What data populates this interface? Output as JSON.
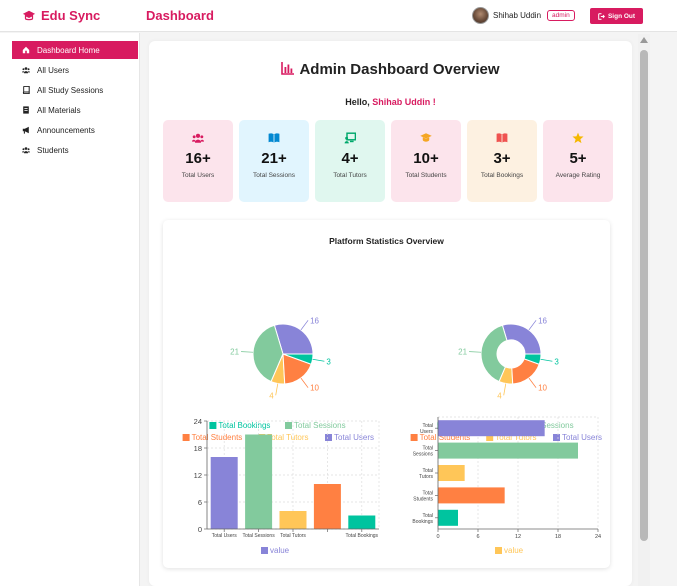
{
  "app": {
    "brand": "Edu Sync",
    "page_title": "Dashboard"
  },
  "user": {
    "name": "Shihab Uddin",
    "role": "admin",
    "sign_out": "Sign Out"
  },
  "sidebar": {
    "items": [
      {
        "label": "Dashboard Home",
        "icon": "home-icon",
        "active": true
      },
      {
        "label": "All Users",
        "icon": "users-icon",
        "active": false
      },
      {
        "label": "All Study Sessions",
        "icon": "book-icon",
        "active": false
      },
      {
        "label": "All Materials",
        "icon": "materials-icon",
        "active": false
      },
      {
        "label": "Announcements",
        "icon": "megaphone-icon",
        "active": false
      },
      {
        "label": "Students",
        "icon": "students-icon",
        "active": false
      }
    ]
  },
  "main": {
    "title": "Admin Dashboard Overview",
    "hello_prefix": "Hello, ",
    "hello_name": "Shihab Uddin !",
    "cards": [
      {
        "value": "16+",
        "label": "Total Users",
        "icon": "users-icon",
        "bg": "#fce4ec",
        "color": "#d81b60"
      },
      {
        "value": "21+",
        "label": "Total Sessions",
        "icon": "book-open-icon",
        "bg": "#e1f5fe",
        "color": "#0288d1"
      },
      {
        "value": "4+",
        "label": "Total Tutors",
        "icon": "chalkboard-icon",
        "bg": "#e0f7ef",
        "color": "#00a86b"
      },
      {
        "value": "10+",
        "label": "Total Students",
        "icon": "graduation-cap-icon",
        "bg": "#fce4ec",
        "color": "#f5a623"
      },
      {
        "value": "3+",
        "label": "Total Bookings",
        "icon": "book-open-icon",
        "bg": "#fdf1e1",
        "color": "#ef5350"
      },
      {
        "value": "5+",
        "label": "Average Rating",
        "icon": "star-icon",
        "bg": "#fce4ec",
        "color": "#f5b800"
      }
    ]
  },
  "stats": {
    "title": "Platform Statistics Overview"
  },
  "chart_data": [
    {
      "type": "pie",
      "categories": [
        "Total Users",
        "Total Sessions",
        "Total Tutors",
        "Total Students",
        "Total Bookings"
      ],
      "values": [
        16,
        21,
        4,
        10,
        3
      ],
      "colors": [
        "#8884d8",
        "#82ca9d",
        "#ffc658",
        "#ff8042",
        "#00c49f"
      ],
      "legend": [
        "Total Bookings",
        "Total Sessions",
        "Total Students",
        "Total Tutors",
        "Total Users"
      ],
      "legend_placement": "bottom"
    },
    {
      "type": "donut",
      "categories": [
        "Total Users",
        "Total Sessions",
        "Total Tutors",
        "Total Students",
        "Total Bookings"
      ],
      "values": [
        16,
        21,
        4,
        10,
        3
      ],
      "colors": [
        "#8884d8",
        "#82ca9d",
        "#ffc658",
        "#ff8042",
        "#00c49f"
      ],
      "legend": [
        "Total Bookings",
        "Total Sessions",
        "Total Students",
        "Total Tutors",
        "Total Users"
      ],
      "legend_placement": "bottom"
    },
    {
      "type": "bar",
      "orientation": "vertical",
      "categories": [
        "Total Users",
        "Total Sessions",
        "Total Tutors",
        "Total Students",
        "Total Bookings"
      ],
      "tick_labels": [
        "Total Users",
        "Total Sessions",
        "Total Tutors",
        "",
        "Total Bookings"
      ],
      "values": [
        16,
        21,
        4,
        10,
        3
      ],
      "colors": [
        "#8884d8",
        "#82ca9d",
        "#ffc658",
        "#ff8042",
        "#00c49f"
      ],
      "ylim": [
        0,
        24
      ],
      "yticks": [
        0,
        6,
        12,
        18,
        24
      ],
      "legend": [
        "value"
      ],
      "legend_color": "#8884d8",
      "grid": true
    },
    {
      "type": "bar",
      "orientation": "horizontal",
      "categories": [
        "Total Users",
        "Total Sessions",
        "Total Tutors",
        "Total Students",
        "Total Bookings"
      ],
      "tick_labels": [
        [
          "Total",
          "Users"
        ],
        [
          "Total",
          "Sessions"
        ],
        [
          "Total",
          "Tutors"
        ],
        [
          "Total",
          "Students"
        ],
        [
          "Total",
          "Bookings"
        ]
      ],
      "values": [
        16,
        21,
        4,
        10,
        3
      ],
      "colors": [
        "#8884d8",
        "#82ca9d",
        "#ffc658",
        "#ff8042",
        "#00c49f"
      ],
      "xlim": [
        0,
        24
      ],
      "xticks": [
        0,
        6,
        12,
        18,
        24
      ],
      "legend": [
        "value"
      ],
      "legend_color": "#ffc658",
      "grid": true
    }
  ]
}
